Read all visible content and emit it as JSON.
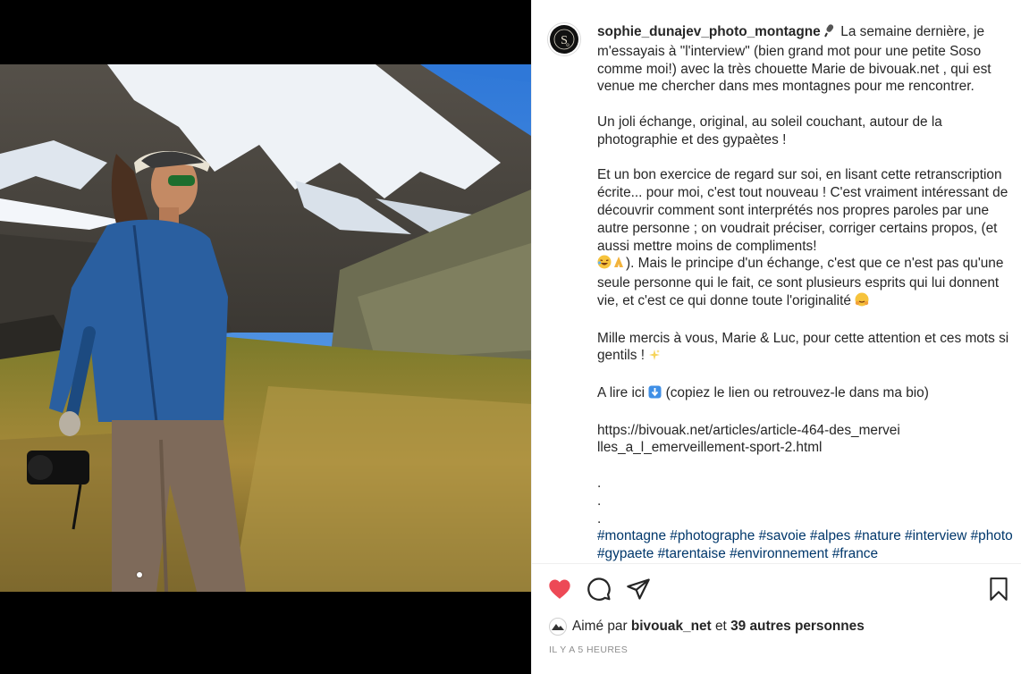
{
  "post": {
    "username": "sophie_dunajev_photo_montagne",
    "caption_lines": [
      "La semaine dernière, je m'essayais à \"l'interview\" (bien grand mot pour une petite Soso comme moi!) avec la très chouette Marie de bivouak.net , qui est venue me chercher dans mes montagnes pour me rencontrer.",
      "Un joli échange, original, au soleil couchant, autour de la photographie et des gypaètes !",
      "Et un bon exercice de regard sur soi, en lisant cette retranscription écrite... pour moi, c'est tout nouveau ! C'est vraiment intéressant de découvrir comment sont interprétés nos propres paroles par une autre personne ; on voudrait préciser, corriger certains propos, (et aussi mettre moins de compliments!",
      "). Mais le principe d'un échange, c'est que ce n'est pas qu'une seule personne qui le fait, ce sont plusieurs esprits qui lui donnent vie, et c'est ce qui donne toute l'originalité",
      "Mille mercis à vous, Marie & Luc, pour cette attention et ces mots si gentils !",
      "A lire ici",
      "(copiez le lien ou retrouvez-le dans ma bio)",
      "https://bivouak.net/articles/article-464-des_merveilles_a_l_emerveillement-sport-2.html"
    ],
    "dots": [
      ".",
      ".",
      "."
    ],
    "hashtags": [
      "#montagne",
      "#photographe",
      "#savoie",
      "#alpes",
      "#nature",
      "#interview",
      "#photo",
      "#gypaete",
      "#tarentaise",
      "#environnement",
      "#france"
    ],
    "icons": {
      "avatar": "logo-so-icon",
      "microphone": "microphone-icon",
      "emoji_laugh": "laughing-face-icon",
      "emoji_pray": "praying-hands-icon",
      "emoji_hug": "hugging-face-icon",
      "emoji_sparkles": "sparkles-icon",
      "emoji_down": "down-arrow-icon"
    }
  },
  "actions": {
    "like_icon": "heart-filled-icon",
    "comment_icon": "comment-icon",
    "share_icon": "share-icon",
    "save_icon": "bookmark-icon"
  },
  "likes": {
    "prefix": "Aimé par",
    "liker": "bivouak_net",
    "conjunction": "et",
    "others": "39 autres personnes"
  },
  "timestamp": "Il y a 5 heures",
  "colors": {
    "like_red": "#ed4956",
    "text": "#262626",
    "hashtag": "#00376b",
    "muted": "#8e8e8e"
  }
}
